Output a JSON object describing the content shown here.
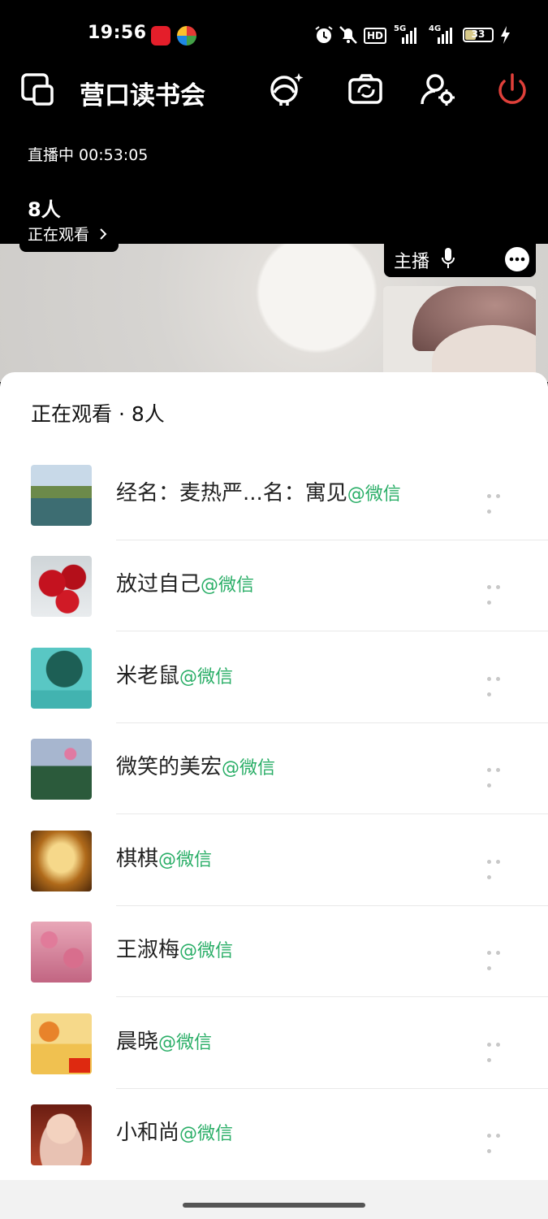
{
  "status_bar": {
    "time": "19:56",
    "hd_label": "HD",
    "net1": "5G",
    "net2": "4G",
    "battery": "33"
  },
  "header": {
    "title": "营口读书会",
    "live_status": "直播中 00:53:05",
    "viewer_count": "8人",
    "viewer_label": "正在观看"
  },
  "host": {
    "label": "主播"
  },
  "sheet": {
    "title": "正在观看 · 8人",
    "viewers": [
      {
        "name": "经名：麦热严...名：寓见",
        "suffix": "@微信"
      },
      {
        "name": "放过自己",
        "suffix": "@微信"
      },
      {
        "name": "米老鼠",
        "suffix": "@微信"
      },
      {
        "name": "微笑的美宏",
        "suffix": "@微信"
      },
      {
        "name": "棋棋",
        "suffix": "@微信"
      },
      {
        "name": "王淑梅",
        "suffix": "@微信"
      },
      {
        "name": "晨晓",
        "suffix": "@微信"
      },
      {
        "name": "小和尚",
        "suffix": "@微信"
      }
    ]
  },
  "colors": {
    "wechat_green": "#2aae67",
    "power_red": "#e0403a"
  }
}
